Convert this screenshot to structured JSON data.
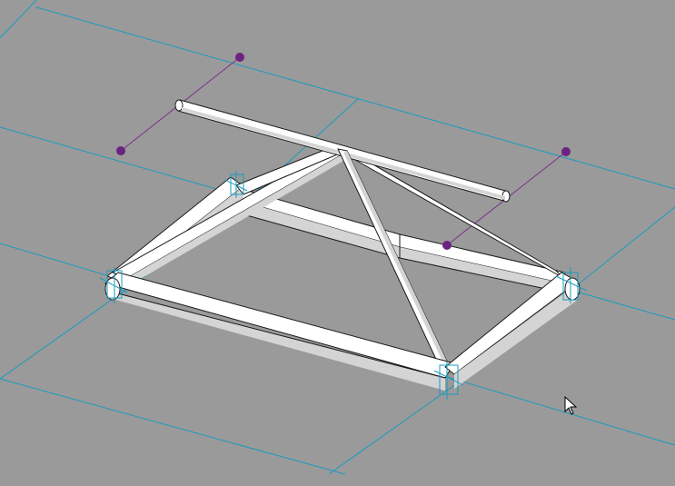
{
  "viewport": {
    "background": "#9a9a9a",
    "grid_color": "#1a9bbf",
    "reference_line_color": "#7a2f8e",
    "handle_color": "#6b2382",
    "member_fill": "#ffffff",
    "member_shade": "#d4d4d4",
    "member_edge": "#1a1a1a",
    "joint_marker_color": "#1a9bbf"
  },
  "scene": {
    "model": "hip-roof-truss-frame",
    "selected_reference_planes": 2,
    "drag_handles": 4
  },
  "cursor": {
    "icon": "arrow-pointer-icon"
  }
}
